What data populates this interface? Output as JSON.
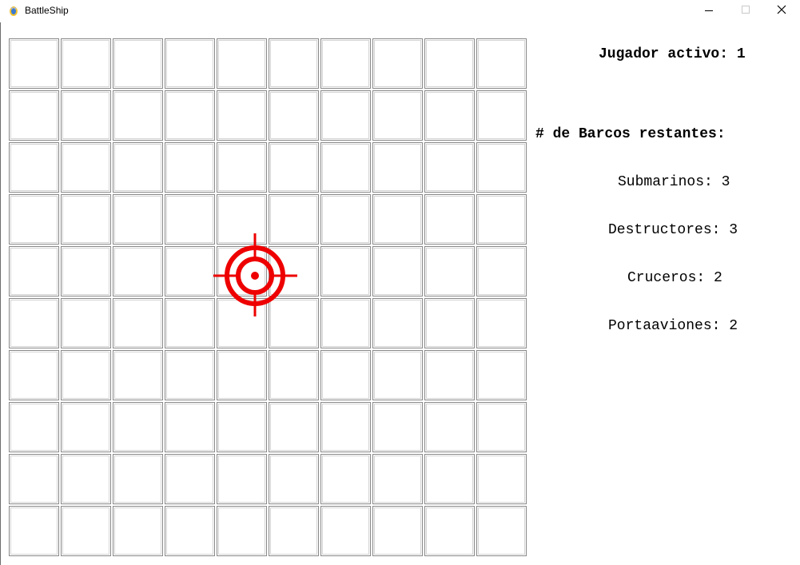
{
  "window": {
    "title": "BattleShip",
    "controls": {
      "minimize": "minimize-icon",
      "maximize": "maximize-icon",
      "close": "close-icon"
    }
  },
  "board": {
    "rows": 10,
    "cols": 10,
    "crosshair_cell": {
      "row": 5,
      "col": 5
    },
    "crosshair_color": "#ee0000"
  },
  "panel": {
    "active_player_label": "Jugador activo: 1",
    "ships_remaining_label": "# de Barcos restantes:",
    "ships": [
      {
        "label": "Submarinos: 3"
      },
      {
        "label": "Destructores: 3"
      },
      {
        "label": "Cruceros: 2"
      },
      {
        "label": "Portaaviones: 2"
      }
    ]
  }
}
